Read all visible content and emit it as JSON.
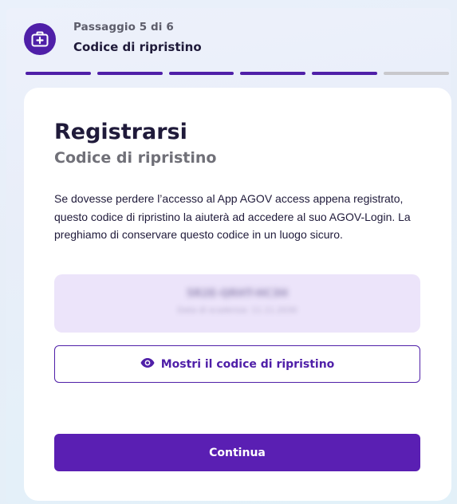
{
  "step": {
    "counter": "Passaggio 5 di 6",
    "title": "Codice di ripristino",
    "icon": "first-aid-kit-icon",
    "total_segments": 6,
    "completed_segments": 5
  },
  "card": {
    "title": "Registrarsi",
    "subtitle": "Codice di ripristino",
    "description": "Se dovesse perdere l’accesso al App AGOV access appena registrato, questo codice di ripristino la aiuterà ad accedere al suo AGOV-Login. La preghiamo di conservare questo codice in un luogo sicuro.",
    "code": {
      "value": "5R2E-QRHT-HC3H",
      "date": "Data di scadenza: 11.11.2030"
    },
    "show_button": {
      "label": "Mostri il codice di ripristino",
      "icon": "eye-icon"
    },
    "continue_button": {
      "label": "Continua"
    }
  },
  "colors": {
    "accent": "#4f1fa8",
    "button_primary": "#5a1fb3",
    "code_background": "#ece4fa",
    "progress_pending": "#c8c8cc"
  }
}
